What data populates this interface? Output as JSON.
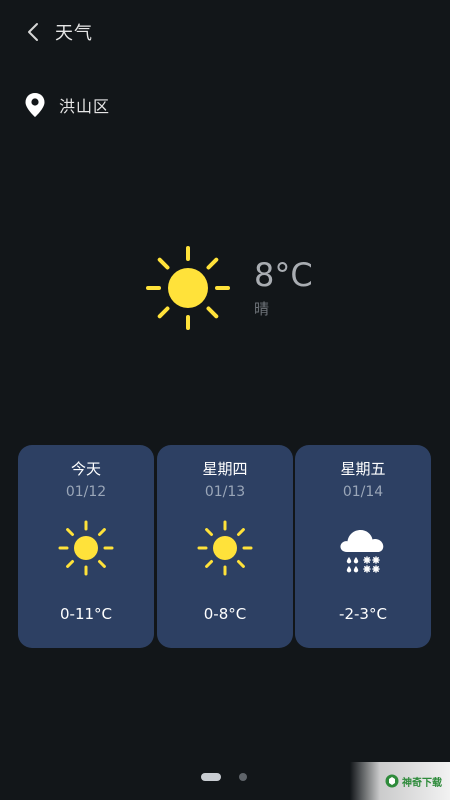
{
  "header": {
    "title": "天气",
    "back_icon": "chevron-left-icon"
  },
  "location": {
    "icon": "location-pin-icon",
    "name": "洪山区"
  },
  "current": {
    "icon": "sun-icon",
    "temperature": "8°C",
    "condition": "晴"
  },
  "forecast": [
    {
      "day": "今天",
      "date": "01/12",
      "icon": "sun-icon",
      "range": "0-11°C"
    },
    {
      "day": "星期四",
      "date": "01/13",
      "icon": "sun-icon",
      "range": "0-8°C"
    },
    {
      "day": "星期五",
      "date": "01/14",
      "icon": "snow-cloud-icon",
      "range": "-2-3°C"
    }
  ],
  "pager": {
    "pages": 2,
    "active_index": 0
  },
  "watermark": {
    "text": "神奇下载"
  },
  "colors": {
    "background": "#121619",
    "card": "#2d4063",
    "sun": "#ffe23a",
    "text_muted": "#a9adb2"
  }
}
